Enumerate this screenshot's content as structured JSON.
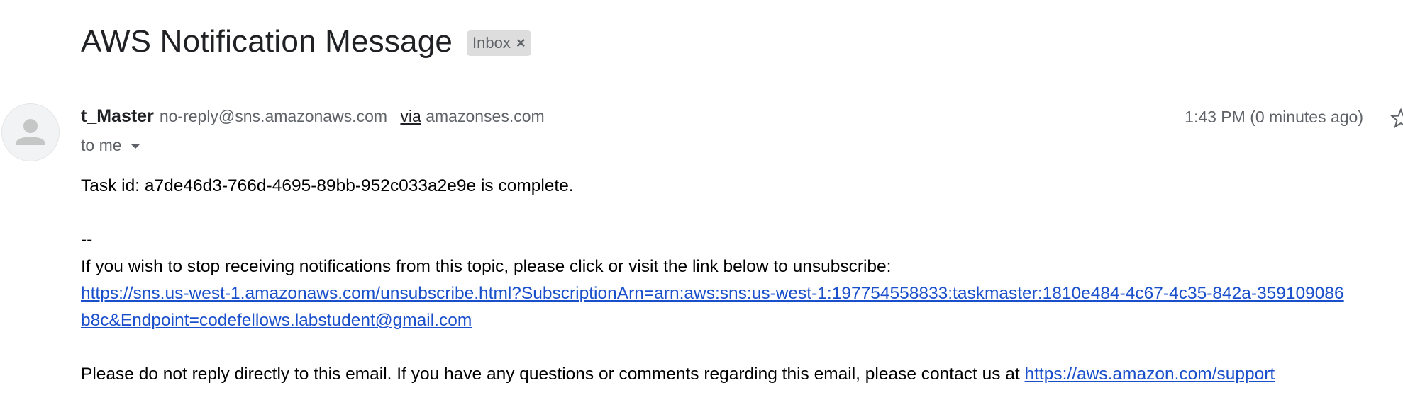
{
  "email": {
    "subject": "AWS Notification Message",
    "label": "Inbox",
    "label_remove_glyph": "×",
    "sender": {
      "name": "t_Master",
      "address": "no-reply@sns.amazonaws.com",
      "via_label": "via",
      "via_domain": "amazonses.com"
    },
    "time": "1:43 PM (0 minutes ago)",
    "recipient": "to me",
    "body": {
      "line1": "Task id: a7de46d3-766d-4695-89bb-952c033a2e9e is complete.",
      "separator": "--",
      "unsubscribe_text": "If you wish to stop receiving notifications from this topic, please click or visit the link below to unsubscribe:",
      "unsubscribe_link": "https://sns.us-west-1.amazonaws.com/unsubscribe.html?SubscriptionArn=arn:aws:sns:us-west-1:197754558833:taskmaster:1810e484-4c67-4c35-842a-359109086b8c&Endpoint=codefellows.labstudent@gmail.com",
      "footer_text": "Please do not reply directly to this email. If you have any questions or comments regarding this email, please contact us at ",
      "support_link": "https://aws.amazon.com/support"
    }
  },
  "icons": {
    "avatar": "person-avatar-icon",
    "details_toggle": "chevron-down-icon",
    "star": "star-icon"
  },
  "colors": {
    "link": "#1a4fcc",
    "label_chip_bg": "#dddddd",
    "muted_text": "#5f6368"
  }
}
